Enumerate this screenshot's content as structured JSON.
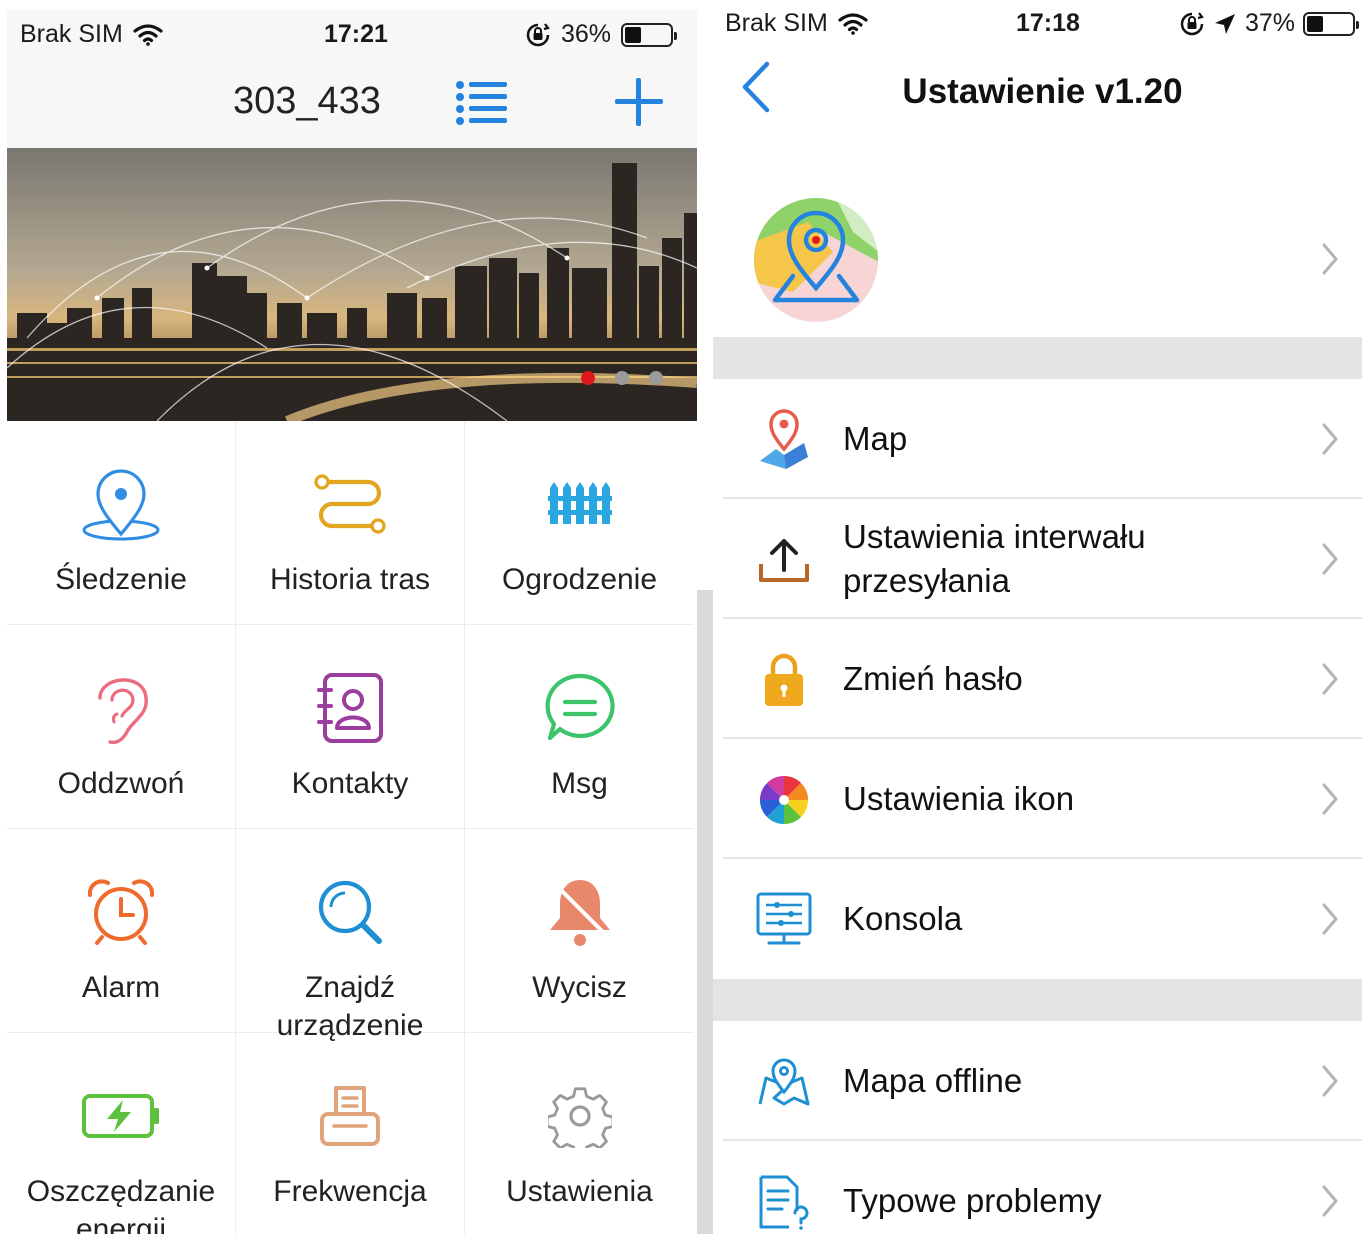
{
  "left": {
    "status": {
      "carrier": "Brak SIM",
      "time": "17:21",
      "battery": "36%",
      "battery_level": 0.36
    },
    "title": "303_433",
    "banner": {
      "active_slide": 1,
      "slides": 3
    },
    "grid": [
      {
        "label": "Śledzenie",
        "icon": "location-pin-icon",
        "color": "#2f8de4"
      },
      {
        "label": "Historia tras",
        "icon": "route-history-icon",
        "color": "#e2a520"
      },
      {
        "label": "Ogrodzenie",
        "icon": "fence-icon",
        "color": "#2aa6e0"
      },
      {
        "label": "Oddzwoń",
        "icon": "ear-icon",
        "color": "#ec6b7e"
      },
      {
        "label": "Kontakty",
        "icon": "contacts-book-icon",
        "color": "#9b3d9e"
      },
      {
        "label": "Msg",
        "icon": "chat-bubble-icon",
        "color": "#3cc46b"
      },
      {
        "label": "Alarm",
        "icon": "alarm-clock-icon",
        "color": "#ef6a2c"
      },
      {
        "label": "Znajdź urządzenie",
        "icon": "search-icon",
        "color": "#1f8fd4"
      },
      {
        "label": "Wycisz",
        "icon": "bell-muted-icon",
        "color": "#e9876b"
      },
      {
        "label": "Oszczędzanie energii",
        "icon": "battery-charge-icon",
        "color": "#5cc13c"
      },
      {
        "label": "Frekwencja",
        "icon": "printer-icon",
        "color": "#e0a47a"
      },
      {
        "label": "Ustawienia",
        "icon": "gear-icon",
        "color": "#999999"
      }
    ]
  },
  "right": {
    "status": {
      "carrier": "Brak SIM",
      "time": "17:18",
      "battery": "37%",
      "battery_level": 0.37
    },
    "title": "Ustawienie v1.20",
    "rows": [
      {
        "label": "Map",
        "icon": "map-pin-icon"
      },
      {
        "label": "Ustawienia interwału przesyłania",
        "icon": "upload-icon"
      },
      {
        "label": "Zmień hasło",
        "icon": "lock-icon"
      },
      {
        "label": "Ustawienia ikon",
        "icon": "color-wheel-icon"
      },
      {
        "label": "Konsola",
        "icon": "console-icon"
      },
      {
        "label": "Mapa offline",
        "icon": "offline-map-icon"
      },
      {
        "label": "Typowe problemy",
        "icon": "faq-document-icon"
      }
    ]
  }
}
